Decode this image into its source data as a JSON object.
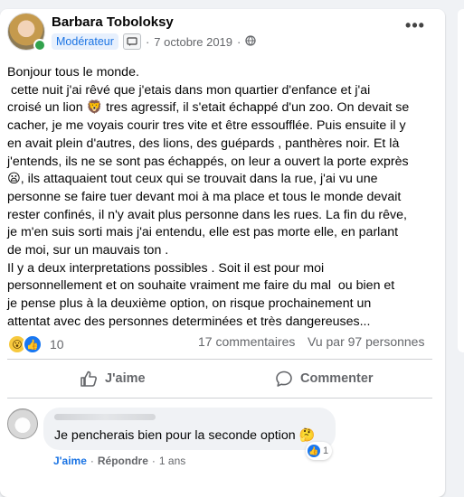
{
  "post": {
    "author": "Barbara Toboloksy",
    "badge": "Modérateur",
    "date": "7 octobre 2019",
    "separator": "·",
    "audience_icon": "globe-icon",
    "more_label": "•••",
    "text_lines": [
      "Bonjour tous le monde.",
      " cette nuit j'ai rêvé que j'etais dans mon quartier d'enfance et j'ai",
      "croisé un lion 🦁 tres agressif, il s'etait échappé d'un zoo. On devait se",
      "cacher, je me voyais courir tres vite et être essoufflée. Puis ensuite il y",
      "en avait plein d'autres, des lions, des guépards , panthères noir. Et là",
      "j'entends, ils ne se sont pas échappés, on leur a ouvert la porte exprès",
      "😦, ils attaquaient tout ceux qui se trouvait dans la rue, j'ai vu une",
      "personne se faire tuer devant moi à ma place et tous le monde devait",
      "rester confinés, il n'y avait plus personne dans les rues. La fin du rêve,",
      "je m'en suis sorti mais j'ai entendu, elle est pas morte elle, en parlant",
      "de moi, sur un mauvais ton .",
      "Il y a deux interpretations possibles . Soit il est pour moi",
      "personnellement et on souhaite vraiment me faire du mal  ou bien et",
      "je pense plus à la deuxième option, on risque prochainement un",
      "attentat avec des personnes determinées et très dangereuses..."
    ]
  },
  "stats": {
    "reaction_wow": "😮",
    "reaction_like": "👍",
    "reaction_count": "10",
    "comments": "17 commentaires",
    "views": "Vu par 97 personnes"
  },
  "actions": {
    "like": "J'aime",
    "comment": "Commenter"
  },
  "comment": {
    "text": "Je pencherais bien pour la seconde option 🤔",
    "like_link": "J'aime",
    "dot": "·",
    "reply_link": "Répondre",
    "time": "1 ans",
    "reaction_icon": "👍",
    "reaction_count": "1"
  }
}
